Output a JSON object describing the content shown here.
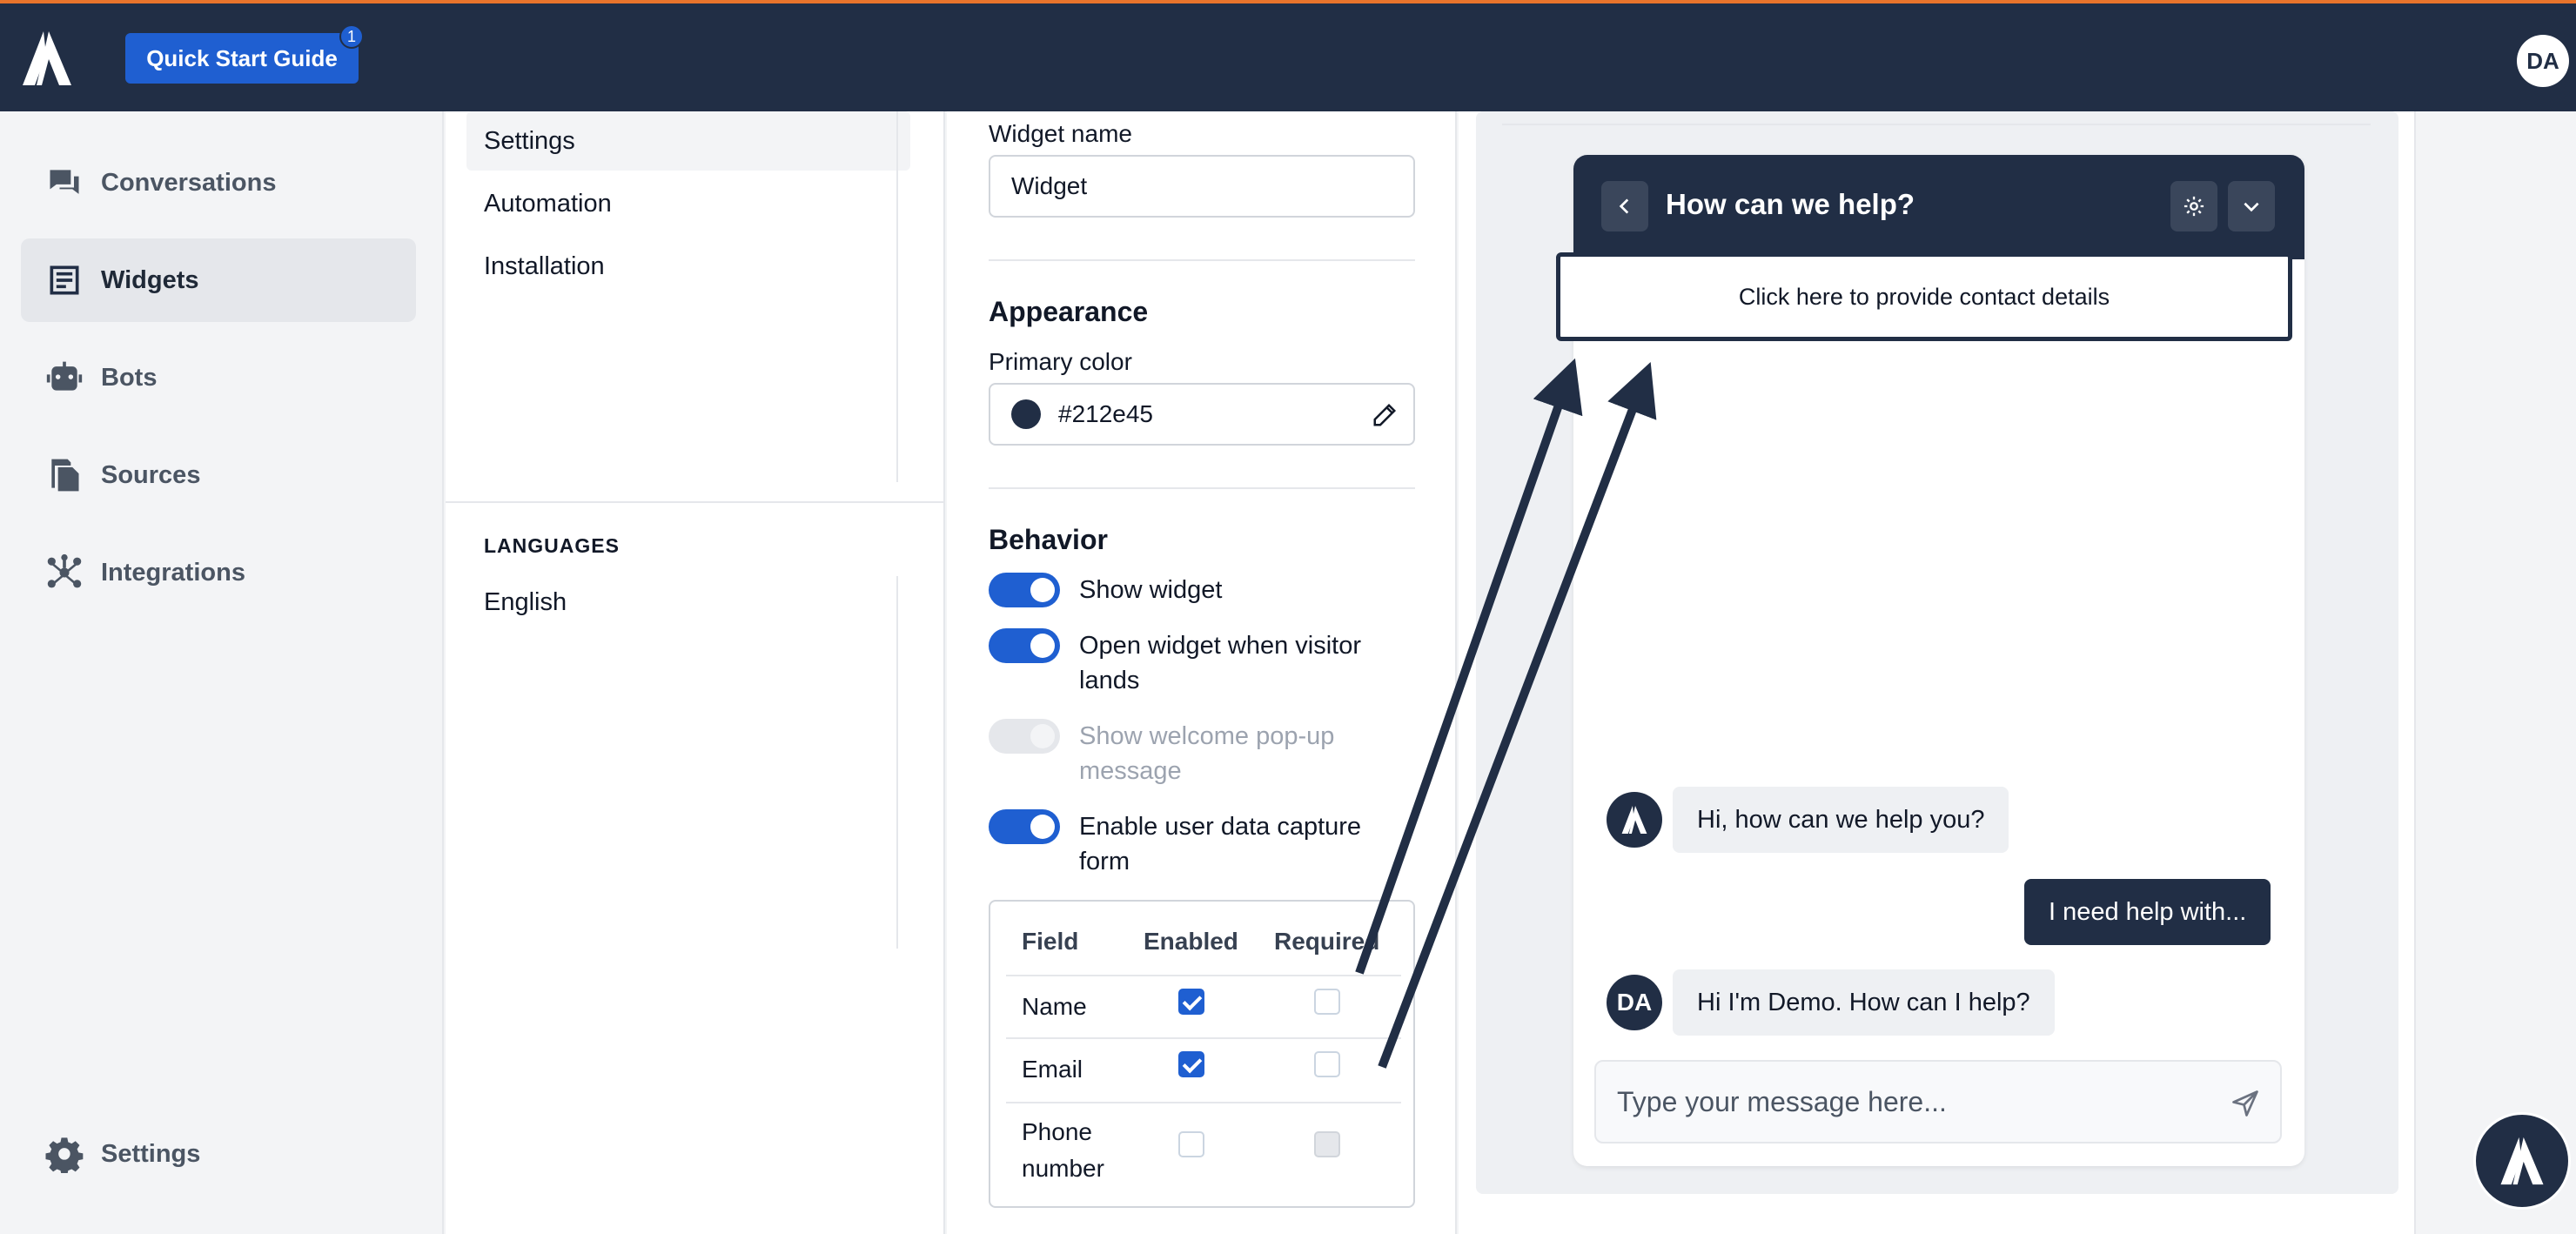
{
  "topbar": {
    "quick_start_label": "Quick Start Guide",
    "quick_start_badge": "1",
    "user_initials": "DA",
    "accent_color": "#e8742c",
    "bg_color": "#212e45"
  },
  "nav": {
    "items": [
      {
        "label": "Conversations",
        "icon": "conversations-icon"
      },
      {
        "label": "Widgets",
        "icon": "widgets-icon",
        "active": true
      },
      {
        "label": "Bots",
        "icon": "bot-icon"
      },
      {
        "label": "Sources",
        "icon": "sources-icon"
      },
      {
        "label": "Integrations",
        "icon": "integrations-icon"
      }
    ],
    "settings_label": "Settings"
  },
  "subnav": {
    "items": [
      {
        "label": "Settings",
        "active": true
      },
      {
        "label": "Automation"
      },
      {
        "label": "Installation"
      }
    ],
    "languages_label": "LANGUAGES",
    "languages": [
      "English"
    ]
  },
  "form": {
    "widget_name_label": "Widget name",
    "widget_name_value": "Widget",
    "appearance_title": "Appearance",
    "primary_color_label": "Primary color",
    "primary_color_value": "#212e45",
    "behavior_title": "Behavior",
    "toggles": [
      {
        "label": "Show widget",
        "on": true
      },
      {
        "label": "Open widget when visitor lands",
        "on": true
      },
      {
        "label": "Show welcome pop-up message",
        "on": false,
        "disabled": true
      },
      {
        "label": "Enable user data capture form",
        "on": true
      }
    ],
    "table": {
      "headers": [
        "Field",
        "Enabled",
        "Required"
      ],
      "rows": [
        {
          "field": "Name",
          "enabled": true,
          "required": false
        },
        {
          "field": "Email",
          "enabled": true,
          "required": false
        },
        {
          "field": "Phone number",
          "enabled": false,
          "required": false,
          "required_disabled": true
        }
      ]
    }
  },
  "preview": {
    "title": "How can we help?",
    "contact_prompt": "Click here to provide contact details",
    "messages": [
      {
        "from": "bot",
        "text": "Hi, how can we help you?"
      },
      {
        "from": "visitor",
        "text": "I need help with..."
      },
      {
        "from": "agent",
        "initials": "DA",
        "text": "Hi I'm Demo. How can I help?"
      }
    ],
    "composer_placeholder": "Type your message here..."
  }
}
